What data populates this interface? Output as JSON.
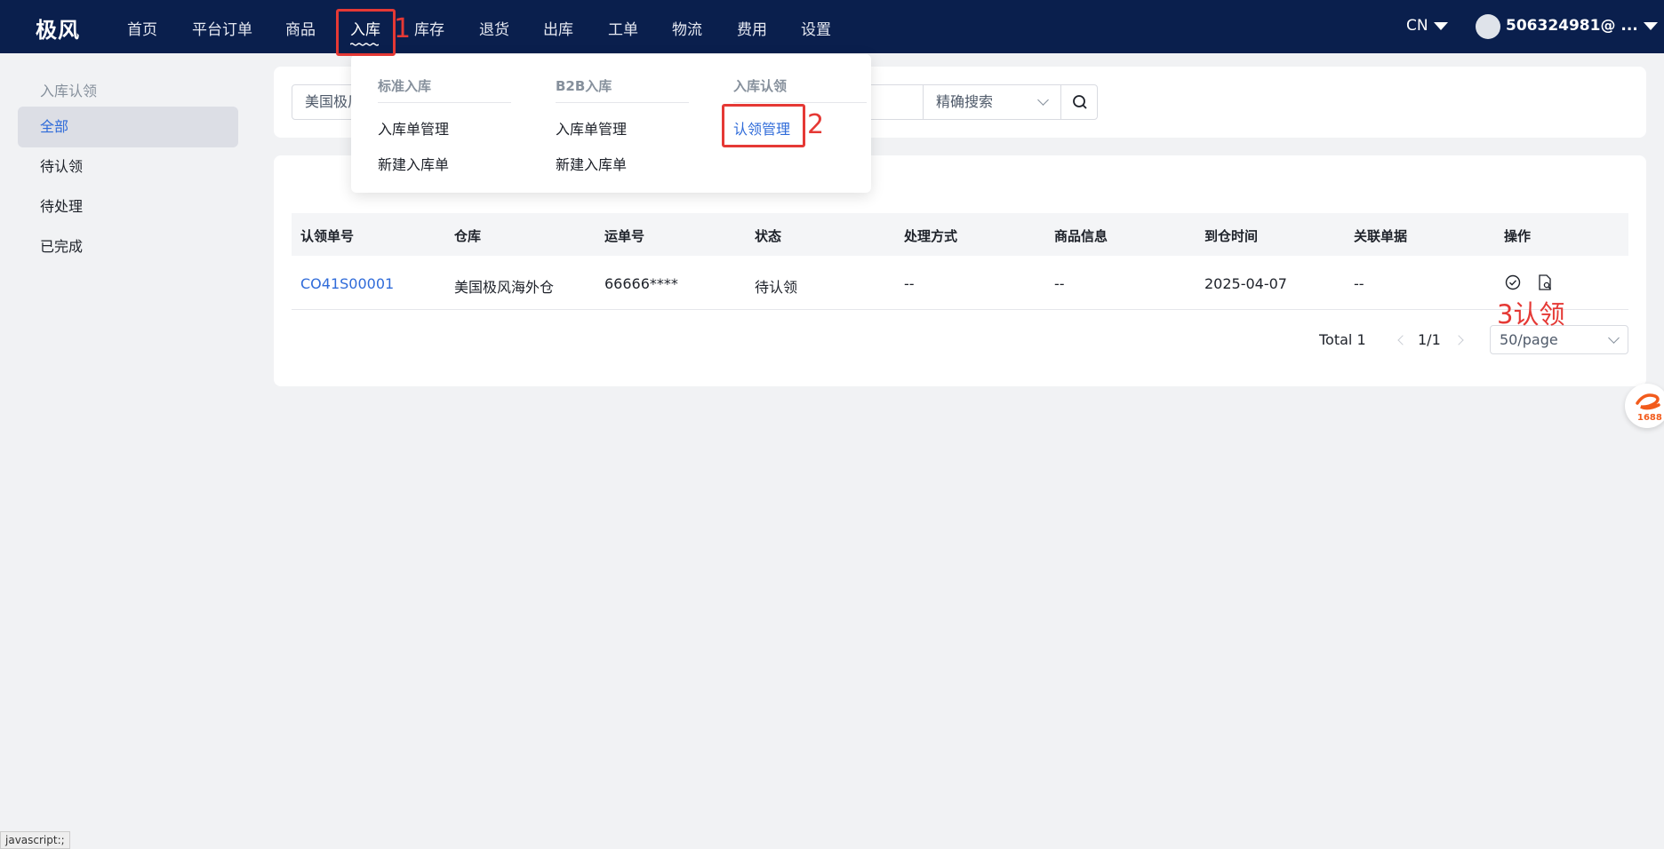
{
  "header": {
    "logo": "极风",
    "nav": [
      "首页",
      "平台订单",
      "商品",
      "入库",
      "库存",
      "退货",
      "出库",
      "工单",
      "物流",
      "费用",
      "设置"
    ],
    "lang": "CN",
    "user": "506324981@ ..."
  },
  "sidebar": {
    "title": "入库认领",
    "items": [
      "全部",
      "待认领",
      "待处理",
      "已完成"
    ]
  },
  "search": {
    "warehouse_value": "美国极风",
    "mode_value": "精确搜索"
  },
  "dropdown": {
    "col1": {
      "head": "标准入库",
      "links": [
        "入库单管理",
        "新建入库单"
      ]
    },
    "col2": {
      "head": "B2B入库",
      "links": [
        "入库单管理",
        "新建入库单"
      ]
    },
    "col3": {
      "head": "入库认领",
      "links": [
        "认领管理"
      ]
    }
  },
  "annotations": [
    "1",
    "2",
    "3认领"
  ],
  "table": {
    "headers": [
      "认领单号",
      "仓库",
      "运单号",
      "状态",
      "处理方式",
      "商品信息",
      "到仓时间",
      "关联单据",
      "操作"
    ],
    "rows": [
      [
        "CO41S00001",
        "美国极风海外仓",
        "66666****",
        "待认领",
        "--",
        "--",
        "2025-04-07",
        "--"
      ]
    ]
  },
  "pager": {
    "total": "Total 1",
    "page": "1/1",
    "size": "50/page"
  },
  "status_bar": "javascript:;",
  "widget": {
    "label": "1688"
  },
  "colors": {
    "header": "#0a1f4d",
    "accent": "#2f6bd9",
    "annotation": "#e53935"
  }
}
